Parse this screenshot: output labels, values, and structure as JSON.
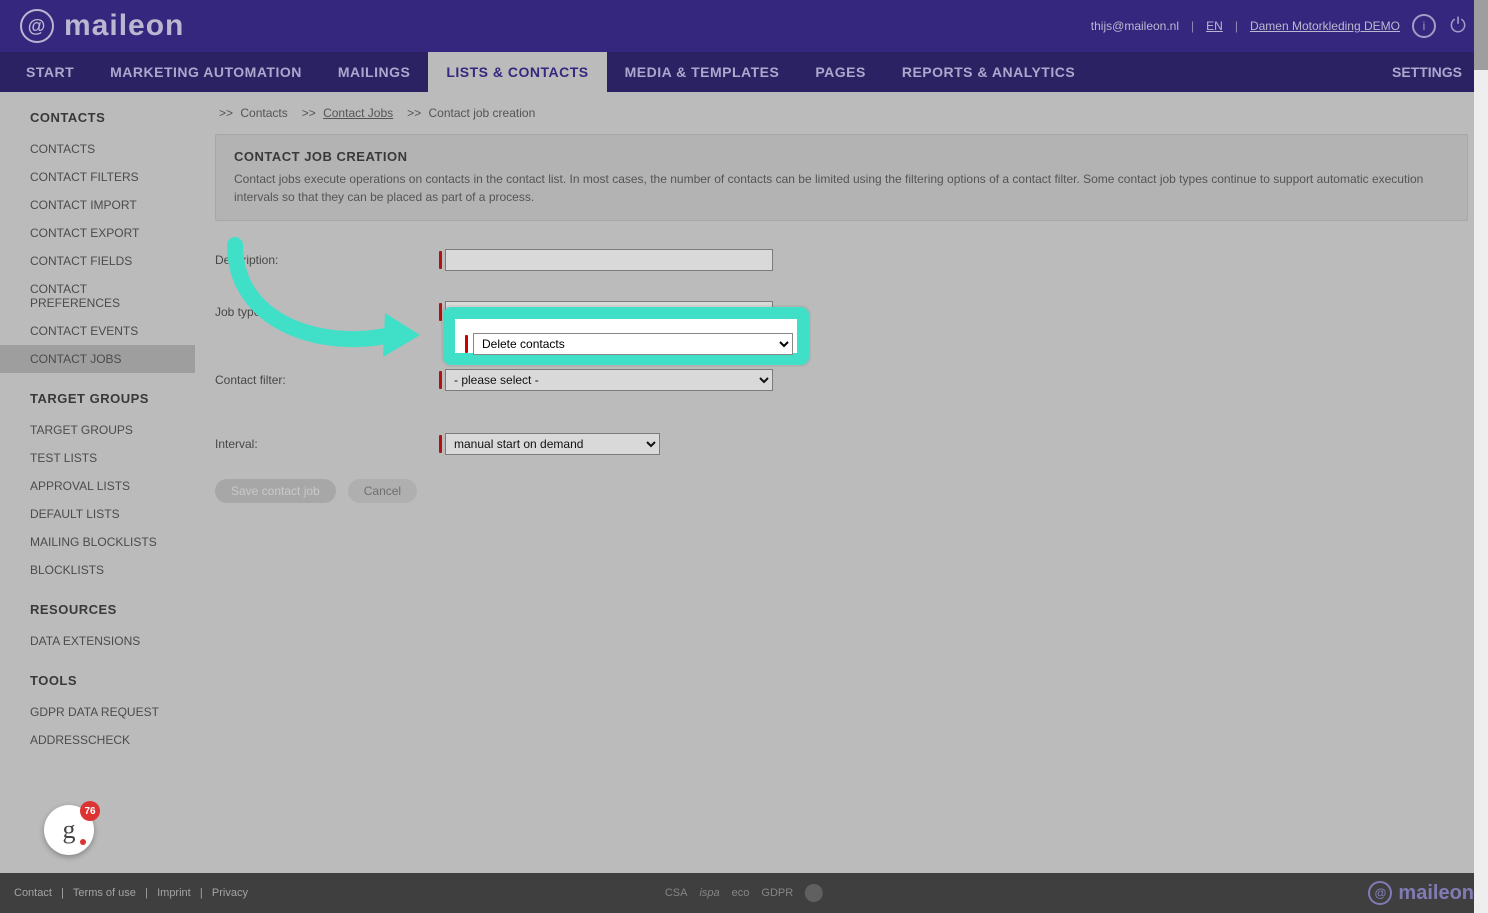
{
  "logo_text": "maileon",
  "user": {
    "email": "thijs@maileon.nl",
    "lang": "EN",
    "account": "Damen Motorkleding DEMO"
  },
  "nav": {
    "items": [
      "START",
      "MARKETING AUTOMATION",
      "MAILINGS",
      "LISTS & CONTACTS",
      "MEDIA & TEMPLATES",
      "PAGES",
      "REPORTS & ANALYTICS"
    ],
    "active_index": 3,
    "right": "SETTINGS"
  },
  "sidebar": {
    "groups": [
      {
        "header": "CONTACTS",
        "items": [
          "CONTACTS",
          "CONTACT FILTERS",
          "CONTACT IMPORT",
          "CONTACT EXPORT",
          "CONTACT FIELDS",
          "CONTACT PREFERENCES",
          "CONTACT EVENTS",
          "CONTACT JOBS"
        ],
        "active_index": 7
      },
      {
        "header": "TARGET GROUPS",
        "items": [
          "TARGET GROUPS",
          "TEST LISTS",
          "APPROVAL LISTS",
          "DEFAULT LISTS",
          "MAILING BLOCKLISTS",
          "BLOCKLISTS"
        ]
      },
      {
        "header": "RESOURCES",
        "items": [
          "DATA EXTENSIONS"
        ]
      },
      {
        "header": "TOOLS",
        "items": [
          "GDPR DATA REQUEST",
          "ADDRESSCHECK"
        ]
      }
    ]
  },
  "breadcrumb": {
    "sep": ">>",
    "items": [
      "Contacts",
      "Contact Jobs",
      "Contact job creation"
    ],
    "link_index": 1
  },
  "panel": {
    "title": "CONTACT JOB CREATION",
    "desc": "Contact jobs execute operations on contacts in the contact list. In most cases, the number of contacts can be limited using the filtering options of a contact filter. Some contact job types continue to support automatic execution intervals so that they can be placed as part of a process."
  },
  "form": {
    "description_label": "Description:",
    "jobtype_label": "Job type:",
    "jobtype_value": "Delete contacts",
    "filter_label": "Contact filter:",
    "filter_value": "- please select -",
    "interval_label": "Interval:",
    "interval_value": "manual start on demand",
    "save_btn": "Save contact job",
    "cancel_btn": "Cancel"
  },
  "footer": {
    "links": [
      "Contact",
      "Terms of use",
      "Imprint",
      "Privacy"
    ],
    "center": [
      "CSA",
      "ispa",
      "eco",
      "GDPR"
    ]
  },
  "chat_badge": "76"
}
